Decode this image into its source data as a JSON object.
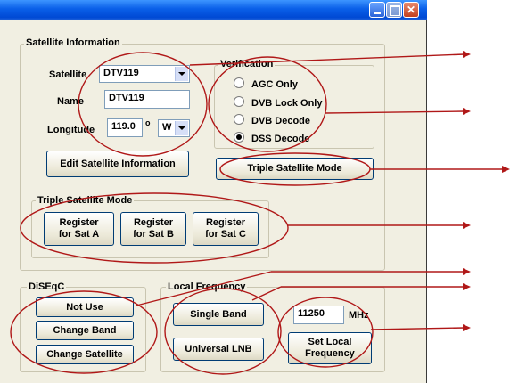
{
  "window": {
    "title_buttons": [
      "minimize",
      "maximize",
      "close"
    ]
  },
  "satellite_info": {
    "group_label": "Satellite Information",
    "satellite_label": "Satellite",
    "satellite_value": "DTV119",
    "name_label": "Name",
    "name_value": "DTV119",
    "longitude_label": "Longitude",
    "longitude_value": "119.0",
    "degree_symbol": "o",
    "direction_value": "W",
    "edit_button": "Edit Satellite Information"
  },
  "verification": {
    "group_label": "Verification",
    "options": [
      "AGC Only",
      "DVB Lock Only",
      "DVB Decode",
      "DSS Decode"
    ],
    "selected": "DSS Decode"
  },
  "triple_mode_button": "Triple Satellite Mode",
  "triple_group": {
    "group_label": "Triple Satellite Mode",
    "buttons": [
      {
        "line1": "Register",
        "line2": "for Sat A"
      },
      {
        "line1": "Register",
        "line2": "for Sat B"
      },
      {
        "line1": "Register",
        "line2": "for Sat C"
      }
    ]
  },
  "diseqc": {
    "group_label": "DiSEqC",
    "buttons": [
      "Not Use",
      "Change Band",
      "Change Satellite"
    ]
  },
  "local_frequency": {
    "group_label": "Local Frequency",
    "single_band": "Single Band",
    "universal_lnb": "Universal LNB",
    "freq_value": "11250",
    "unit": "MHz",
    "set_button_line1": "Set Local",
    "set_button_line2": "Frequency"
  },
  "colors": {
    "annotation": "#b01818",
    "titlebar": "#0a5fe8"
  }
}
